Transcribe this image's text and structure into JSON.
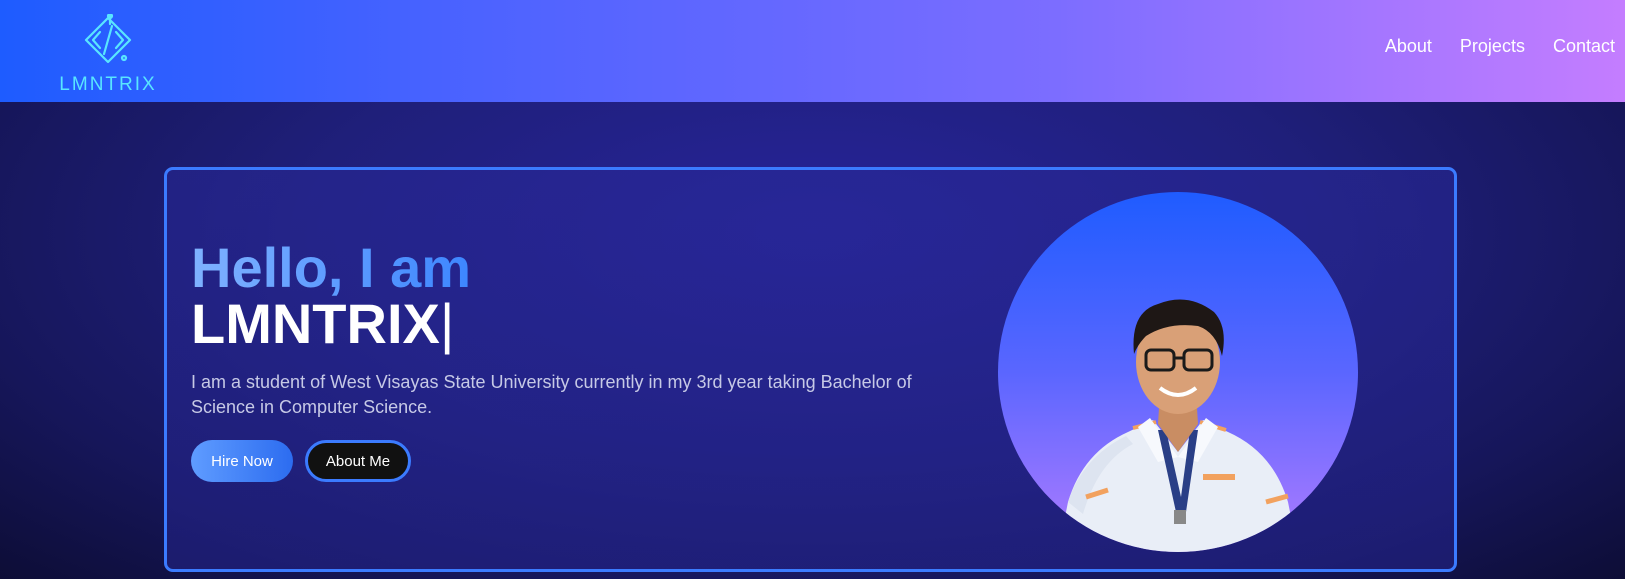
{
  "brand": {
    "logo_text": "LMNTRIX",
    "logo_icon": "code-circuit-icon",
    "logo_color": "#59e6ff"
  },
  "nav": {
    "links": [
      "About",
      "Projects",
      "Contact"
    ]
  },
  "hero": {
    "greeting": "Hello, I am",
    "name": "LMNTRIX",
    "cursor": "|",
    "description": "I am a student of West Visayas State University currently in my 3rd year taking Bachelor of Science in Computer Science.",
    "buttons": {
      "hire": "Hire Now",
      "about": "About Me"
    },
    "portrait": "profile-photo"
  },
  "colors": {
    "nav_gradient_start": "#1e5cff",
    "nav_gradient_end": "#c47dff",
    "accent": "#3b7bff",
    "background": "#1f1f7a"
  }
}
